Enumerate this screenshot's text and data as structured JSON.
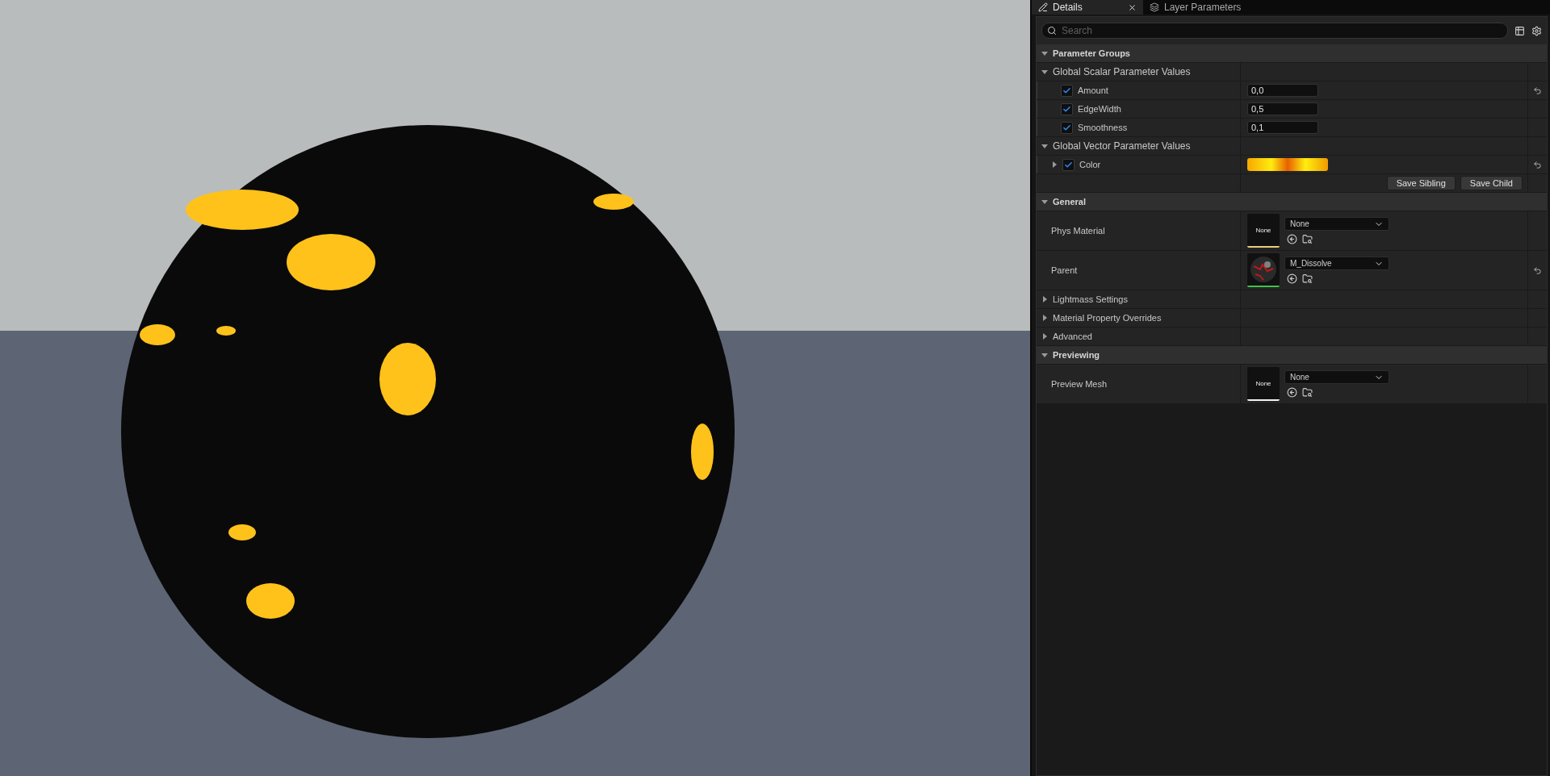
{
  "tabs": [
    {
      "label": "Details",
      "selected": true,
      "closable": true
    },
    {
      "label": "Layer Parameters",
      "selected": false,
      "closable": false
    }
  ],
  "search": {
    "placeholder": "Search"
  },
  "parameter_groups": {
    "title": "Parameter Groups",
    "expanded": true,
    "groups": [
      {
        "title": "Global Scalar Parameter Values",
        "expanded": true,
        "params": [
          {
            "kind": "scalar",
            "name": "Amount",
            "checked": true,
            "value": "0,0",
            "overridden": true
          },
          {
            "kind": "scalar",
            "name": "EdgeWidth",
            "checked": true,
            "value": "0,5",
            "overridden": false
          },
          {
            "kind": "scalar",
            "name": "Smoothness",
            "checked": true,
            "value": "0,1",
            "overridden": false
          }
        ]
      },
      {
        "title": "Global Vector Parameter Values",
        "expanded": true,
        "params": [
          {
            "kind": "color",
            "name": "Color",
            "checked": true,
            "expanded": false,
            "overridden": true
          }
        ]
      }
    ],
    "buttons": [
      "Save Sibling",
      "Save Child"
    ]
  },
  "sections": [
    {
      "title": "General",
      "expanded": true,
      "rows": [
        {
          "kind": "asset",
          "name": "Phys Material",
          "thumbnail_label": "None",
          "color": "#e6cf7a",
          "value": "None",
          "overridden": false
        },
        {
          "kind": "asset",
          "name": "Parent",
          "color": "#3fc24a",
          "value": "M_Dissolve",
          "overridden": true
        },
        {
          "kind": "category",
          "name": "Lightmass Settings",
          "expanded": false
        },
        {
          "kind": "category",
          "name": "Material Property Overrides",
          "expanded": false
        },
        {
          "kind": "category",
          "name": "Advanced",
          "expanded": false
        }
      ]
    },
    {
      "title": "Previewing",
      "expanded": true,
      "rows": [
        {
          "kind": "asset",
          "name": "Preview Mesh",
          "thumbnail_label": "None",
          "color": "#f2f2f2",
          "value": "None",
          "overridden": false
        }
      ]
    }
  ]
}
